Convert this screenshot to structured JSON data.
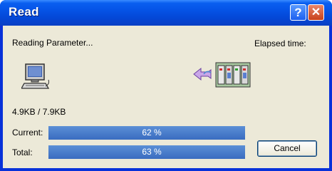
{
  "window": {
    "title": "Read"
  },
  "status": {
    "message": "Reading Parameter...",
    "elapsed_label": "Elapsed time:",
    "size_text": "4.9KB / 7.9KB"
  },
  "progress": {
    "current": {
      "label": "Current:",
      "percent": 62,
      "text": "62 %"
    },
    "total": {
      "label": "Total:",
      "percent": 63,
      "text": "63 %"
    }
  },
  "buttons": {
    "cancel_label": "Cancel"
  },
  "icons": {
    "help": "help-icon",
    "close": "close-icon",
    "computer": "computer-icon",
    "transfer": "transfer-arrow-icon",
    "plc": "plc-rack-icon"
  },
  "colors": {
    "title_bar": "#0553e6",
    "progress_fill": "#4a7cc9",
    "client_bg": "#ece9d8"
  }
}
